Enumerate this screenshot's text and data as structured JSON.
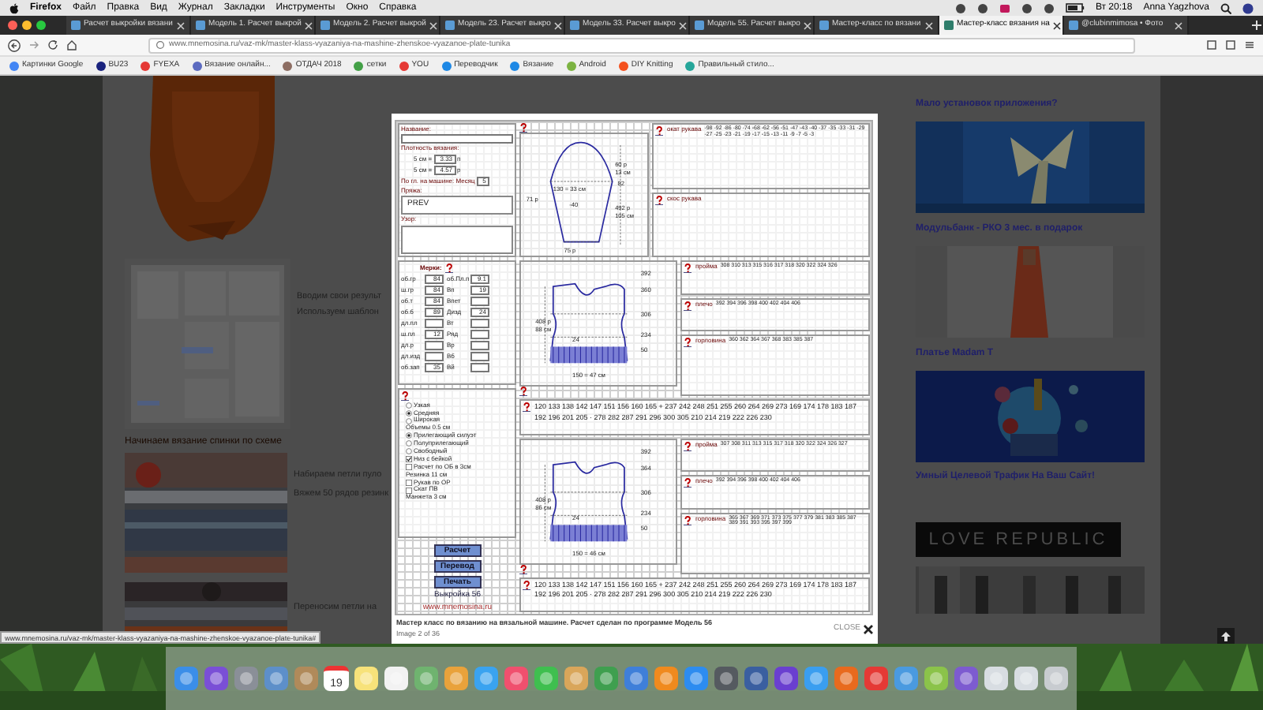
{
  "menu_bar": {
    "items": [
      "Firefox",
      "Файл",
      "Правка",
      "Вид",
      "Журнал",
      "Закладки",
      "Инструменты",
      "Окно",
      "Справка"
    ],
    "clock": "Вт 20:18",
    "user": "Anna Yagzhova"
  },
  "tabs": [
    {
      "label": "Расчет выкройки вязани",
      "selected": false
    },
    {
      "label": "Модель 1. Расчет выкрой",
      "selected": false
    },
    {
      "label": "Модель 2. Расчет выкрой",
      "selected": false
    },
    {
      "label": "Модель 23. Расчет выкро",
      "selected": false
    },
    {
      "label": "Модель 33. Расчет выкро",
      "selected": false
    },
    {
      "label": "Модель 55. Расчет выкро",
      "selected": false
    },
    {
      "label": "Мастер-класс по вязани",
      "selected": false
    },
    {
      "label": "Мастер-класс вязания на",
      "selected": true
    },
    {
      "label": "@clubinmimosa • Фото",
      "selected": false
    }
  ],
  "address_bar": {
    "url": "www.mnemosina.ru/vaz-mk/master-klass-vyazaniya-na-mashine-zhenskoe-vyazanoe-plate-tunika"
  },
  "bookmarks": [
    {
      "label": "Картинки Google",
      "color": "#4285f4"
    },
    {
      "label": "BU23",
      "color": "#1a237e"
    },
    {
      "label": "FYEXA",
      "color": "#e53935"
    },
    {
      "label": "Вязание онлайн...",
      "color": "#5c6bc0"
    },
    {
      "label": "ОТДАЧ 2018",
      "color": "#8d6e63"
    },
    {
      "label": "сетки",
      "color": "#43a047"
    },
    {
      "label": "YOU",
      "color": "#e53935"
    },
    {
      "label": "Переводчик",
      "color": "#1e88e5"
    },
    {
      "label": "Вязание",
      "color": "#1e88e5"
    },
    {
      "label": "Android",
      "color": "#7cb342"
    },
    {
      "label": "DIY Knitting",
      "color": "#f4511e"
    },
    {
      "label": "Правильный стило...",
      "color": "#26a69a"
    }
  ],
  "article": {
    "texts_top": [
      "Вводим свои результ",
      "Используем шаблон"
    ],
    "heading": "Начинаем вязание спинки по схеме",
    "texts_middle": [
      "Набираем петли пуло",
      "Вяжем 50 рядов резинк"
    ],
    "texts_bottom": [
      "Переносим петли на"
    ]
  },
  "sidebar": {
    "links": [
      "Мало установок приложения?",
      "Модульбанк - РКО 3 мес. в подарок",
      "Платье Madam T",
      "Умный Целевой Трафик На Ваш Сайт!"
    ],
    "banner": "LOVE REPUBLIC"
  },
  "lightbox": {
    "caption": "Мастер класс по вязанию на вязальной машине. Расчет сделан по программе Модель 56",
    "counter": "Image 2 of 36",
    "close": "CLOSE"
  },
  "pattern": {
    "info": {
      "name_label": "Название:",
      "density_label": "Плотность вязания:",
      "density": [
        {
          "label": "5 см =",
          "value": "3.33",
          "unit": "п"
        },
        {
          "label": "5 см =",
          "value": "4.57",
          "unit": "р"
        }
      ],
      "machine_label": "По гл. на машине: Месяц",
      "machine_value": "5",
      "yarn_label": "Пряжа:",
      "yarn_value": "PREV",
      "stitch_label": "Узор:"
    },
    "measures": {
      "title": "Мерки:",
      "rows": [
        {
          "label": "об.гр",
          "value": "84",
          "label2": "об.Пл.п",
          "value2": "9.1"
        },
        {
          "label": "ш.гр",
          "value": "84",
          "label2": "Вп",
          "value2": "19"
        },
        {
          "label": "об.т",
          "value": "84",
          "label2": "Впет"
        },
        {
          "label": "об.б",
          "value": "89",
          "label2": "Дизд",
          "value2": "24"
        },
        {
          "label": "дл.пл",
          "label2": "Вт"
        },
        {
          "label": "ш.пл",
          "value": "12",
          "label2": "Ряд"
        },
        {
          "label": "дл.р",
          "label2": "Вр"
        },
        {
          "label": "дл.изд",
          "label2": "Вб"
        },
        {
          "label": "об.зап",
          "value": "35",
          "label2": "Вй"
        }
      ]
    },
    "options": [
      {
        "kind": "radio",
        "label": "Узкая",
        "checked": false
      },
      {
        "kind": "radio",
        "label": "Средняя",
        "checked": true
      },
      {
        "kind": "radio",
        "label": "Широкая",
        "checked": false
      },
      {
        "kind": "text",
        "label": "Объемы 0.5 см"
      },
      {
        "kind": "radio",
        "label": "Прилегающий силуэт",
        "checked": true
      },
      {
        "kind": "radio",
        "label": "Полуприлегающий",
        "checked": false
      },
      {
        "kind": "radio",
        "label": "Свободный",
        "checked": false
      },
      {
        "kind": "check",
        "label": "Низ с бейкой",
        "checked": true
      },
      {
        "kind": "check",
        "label": "Расчет по ОБ в 3см",
        "checked": false
      },
      {
        "kind": "text",
        "label": "Резинка 11 см"
      },
      {
        "kind": "check",
        "label": "Рукав по ОР",
        "checked": false
      },
      {
        "kind": "check",
        "label": "Скат ПВ",
        "checked": false
      },
      {
        "kind": "text",
        "label": "Манжета 3 см"
      }
    ],
    "buttons": [
      "Расчет",
      "Перевод",
      "Печать"
    ],
    "model": "Выкройка 56",
    "site": "www.mnemosina.ru",
    "sleeve": {
      "labels": [
        "60 р",
        "13 см",
        "82",
        "130 = 33 см",
        "71 р",
        "-40",
        "492 р",
        "105 см",
        "75 р"
      ]
    },
    "sleeve_panels": [
      {
        "title": "окат рукава",
        "numbers": "-98 -92 -86 -80 -74 -68 -62 -56 -51 -47 -43 -40 -37 -35 -33 -31 -29 -27 -25 -23 -21 -19 -17 -15 -13 -11 -9 -7 -5 -3"
      },
      {
        "title": "скос рукава"
      }
    ],
    "blocks": [
      {
        "labels": [
          "392",
          "360",
          "306",
          "408 р",
          "88 см",
          "234",
          "24",
          "50",
          "150 = 47 см"
        ],
        "panels": [
          {
            "title": "пройма",
            "numbers": "308 310 313 315 316 317 318 320 322 324 326"
          },
          {
            "title": "плечо",
            "numbers": "392 394 396 398 400 402 404 406"
          },
          {
            "title": "горловина",
            "numbers": "360 362 364 367 368 383 385 387"
          }
        ],
        "numbers": "120 133 138 142 147 151 156 160 165 + 237 242 248 251 255 260 264 269 273 169 174 178 183 187 192 196 201 205 · 278 282 287 291 296 300 305 210 214 219 222 226 230"
      },
      {
        "labels": [
          "392",
          "364",
          "306",
          "408 р",
          "86 см",
          "234",
          "24",
          "50",
          "150 = 46 см"
        ],
        "panels": [
          {
            "title": "пройма",
            "numbers": "307 308 311 313 315 317 318 320 322 324 326 327"
          },
          {
            "title": "плечо",
            "numbers": "392 394 396 398 400 402 404 406"
          },
          {
            "title": "горловина",
            "numbers": "365 367 369 371 373 375 377 379 381 383 385 387 389 391 393 395 397 399"
          }
        ],
        "numbers": "120 133 138 142 147 151 156 160 165 + 237 242 248 251 255 260 264 269 273 169 174 178 183 187 192 196 201 205 · 278 282 287 291 296 300 305 210 214 219 222 226 230"
      }
    ]
  },
  "status_url": "www.mnemosina.ru/vaz-mk/master-klass-vyazaniya-na-mashine-zhenskoe-vyazanoe-plate-tunika#",
  "dock": [
    {
      "color": "#3b8ee8"
    },
    {
      "color": "#7a4fd6"
    },
    {
      "color": "#8a8f98"
    },
    {
      "color": "#5d8fc9"
    },
    {
      "color": "#b08a5a"
    },
    {
      "color": "#ffffff",
      "label": "19"
    },
    {
      "color": "#f7e27a"
    },
    {
      "color": "#f2f2f2"
    },
    {
      "color": "#6fb36f"
    },
    {
      "color": "#e9a23b"
    },
    {
      "color": "#3aa3f0"
    },
    {
      "color": "#f0506e"
    },
    {
      "color": "#3fbf4f"
    },
    {
      "color": "#d9a65a"
    },
    {
      "color": "#3f9f4f"
    },
    {
      "color": "#3f7fd9"
    },
    {
      "color": "#f08a1e"
    },
    {
      "color": "#2d8cf0"
    },
    {
      "color": "#555a60"
    },
    {
      "color": "#3a5fa0"
    },
    {
      "color": "#6a3fd0"
    },
    {
      "color": "#3a9ef0"
    },
    {
      "color": "#e86a1e"
    },
    {
      "color": "#e53935"
    },
    {
      "color": "#4a9ae0"
    },
    {
      "color": "#8bc34a"
    },
    {
      "color": "#7d5bd0"
    },
    {
      "color": "#d8dde2"
    },
    {
      "color": "#d8dde2"
    },
    {
      "color": "#c8ccd0"
    }
  ]
}
